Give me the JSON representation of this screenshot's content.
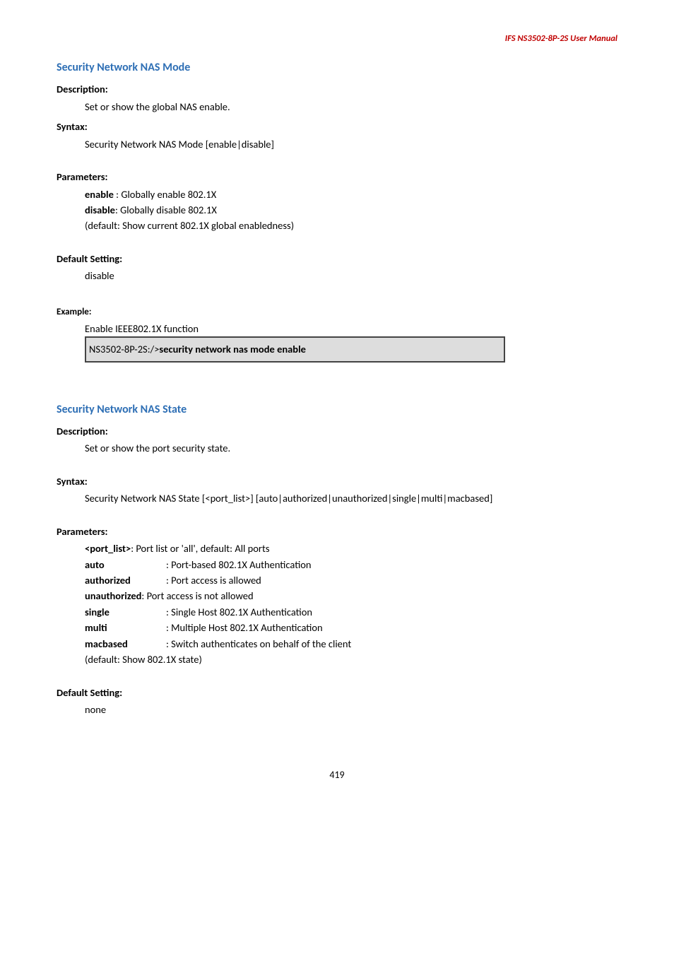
{
  "header": {
    "title": "IFS  NS3502-8P-2S  User  Manual"
  },
  "sec1": {
    "title": "Security Network NAS Mode",
    "description_label": "Description:",
    "description_text": "Set or show the global NAS enable.",
    "syntax_label": "Syntax:",
    "syntax_text": "Security Network NAS Mode [enable|disable]",
    "parameters_label": "Parameters:",
    "param_enable_key": "enable",
    "param_enable_text": " : Globally enable 802.1X",
    "param_disable_key": "disable",
    "param_disable_text": ": Globally disable 802.1X",
    "param_default": "(default: Show current 802.1X global enabledness)",
    "default_label": "Default Setting:",
    "default_value": "disable",
    "example_label": "Example:",
    "example_text": "Enable IEEE802.1X function",
    "code_prefix": "NS3502-8P-2S:/>",
    "code_cmd": "security network nas mode enable"
  },
  "sec2": {
    "title": "Security Network NAS State",
    "description_label": "Description:",
    "description_text": "Set or show the port security state.",
    "syntax_label": "Syntax:",
    "syntax_text": "Security Network NAS State [<port_list>] [auto|authorized|unauthorized|single|multi|macbased]",
    "parameters_label": "Parameters:",
    "p_portlist_key": "<port_list>",
    "p_portlist_text": ": Port list or 'all', default: All ports",
    "p_auto_key": "auto",
    "p_auto_text": ": Port-based 802.1X Authentication",
    "p_authorized_key": "authorized",
    "p_authorized_text": ": Port access is allowed",
    "p_unauthorized_key": "unauthorized",
    "p_unauthorized_text": ": Port access is not allowed",
    "p_single_key": "single",
    "p_single_text": ": Single Host 802.1X Authentication",
    "p_multi_key": "multi",
    "p_multi_text": ": Multiple Host 802.1X Authentication",
    "p_macbased_key": "macbased",
    "p_macbased_text": ": Switch authenticates on behalf of the client",
    "p_default": "(default: Show 802.1X state)",
    "default_label": "Default Setting:",
    "default_value": "none"
  },
  "page_num": "419"
}
